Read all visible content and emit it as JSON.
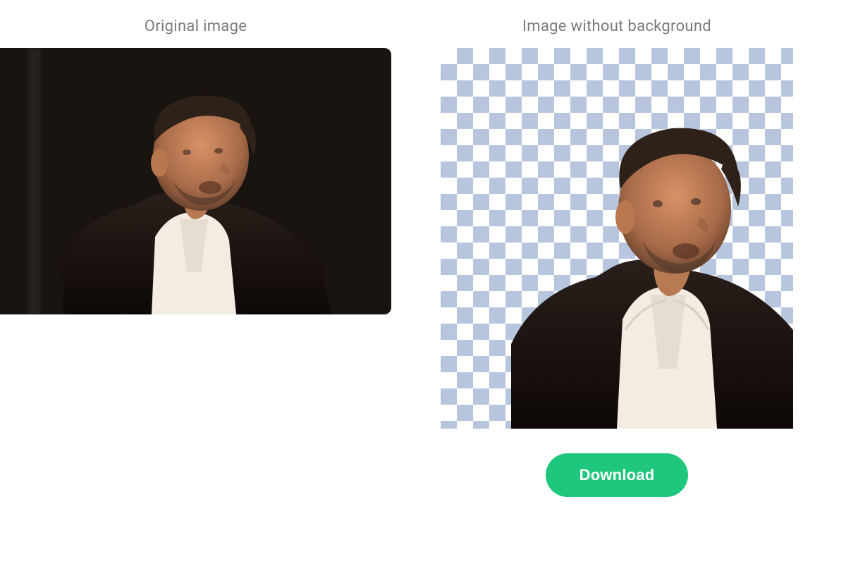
{
  "panels": {
    "original": {
      "title": "Original image"
    },
    "removed": {
      "title": "Image without background"
    }
  },
  "actions": {
    "download_label": "Download"
  },
  "colors": {
    "accent": "#1ec77b",
    "checker": "#b8c5de",
    "text_muted": "#7a7a7a"
  },
  "icons": {
    "person": "person-silhouette"
  }
}
